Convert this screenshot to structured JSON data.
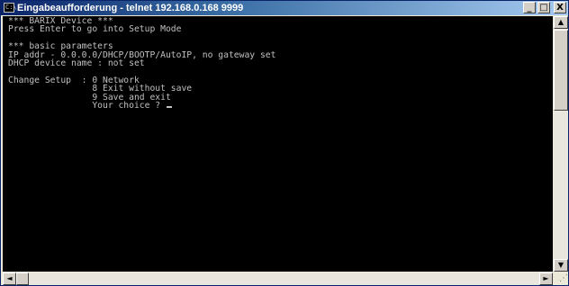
{
  "window": {
    "title": "Eingabeaufforderung - telnet 192.168.0.168 9999",
    "icon": "console-icon",
    "buttons": {
      "minimize": "_",
      "maximize": "□",
      "close": "X"
    }
  },
  "console": {
    "lines": [
      "*** BARIX Device ***",
      "Press Enter to go into Setup Mode",
      "",
      "*** basic parameters",
      "IP addr - 0.0.0.0/DHCP/BOOTP/AutoIP, no gateway set",
      "DHCP device name : not set",
      "",
      "Change Setup  : 0 Network",
      "                8 Exit without save",
      "                9 Save and exit",
      "                Your choice ? "
    ]
  },
  "scrollbars": {
    "up": "▲",
    "down": "▼",
    "left": "◄",
    "right": "►"
  },
  "colors": {
    "console_bg": "#000000",
    "console_fg": "#c0c0c0",
    "title_active": "#0a246a"
  }
}
